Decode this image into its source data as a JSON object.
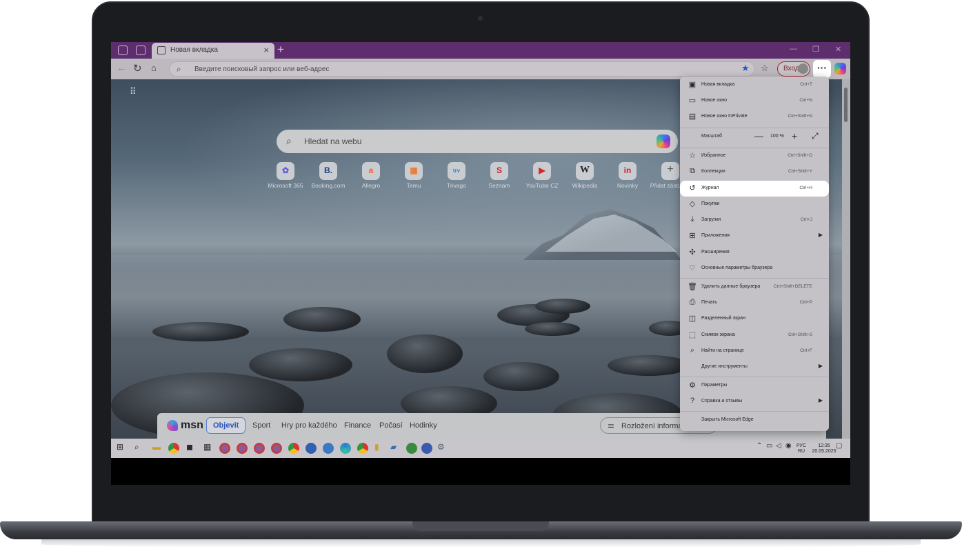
{
  "browser": {
    "tab_title": "Новая вкладка",
    "address_placeholder": "Введите поисковый запрос или веб-адрес",
    "signin_label": "Вход"
  },
  "newtab": {
    "search_placeholder": "Hledat na webu",
    "quick_links": [
      {
        "label": "Microsoft 365",
        "glyph": "✿",
        "color": "#5b5fd8"
      },
      {
        "label": "Booking.com",
        "glyph": "B.",
        "color": "#1f3f8a"
      },
      {
        "label": "Allegro",
        "glyph": "a",
        "color": "#e8622b"
      },
      {
        "label": "Temu",
        "glyph": "▦",
        "color": "#f07a2a"
      },
      {
        "label": "Trivago",
        "glyph": "trv",
        "color": "#2a8ad0"
      },
      {
        "label": "Seznam",
        "glyph": "S",
        "color": "#c8202a"
      },
      {
        "label": "YouTube CZ",
        "glyph": "▶",
        "color": "#d8262a"
      },
      {
        "label": "Wikipedia",
        "glyph": "W",
        "color": "#222222"
      },
      {
        "label": "Novinky",
        "glyph": "in",
        "color": "#c8203a"
      },
      {
        "label": "Přidat zástupce",
        "glyph": "+",
        "color": "#555555"
      }
    ],
    "msn": {
      "logo": "msn",
      "nav": [
        "Objevit",
        "Sport",
        "Hry pro každého",
        "Finance",
        "Počasí",
        "Hodinky"
      ],
      "layout_button": "Rozložení informací"
    }
  },
  "menu": {
    "items": [
      {
        "label": "Новая вкладка",
        "shortcut": "Ctrl+T",
        "icon": "new-tab-icon",
        "glyph": "▣"
      },
      {
        "label": "Новое окно",
        "shortcut": "Ctrl+N",
        "icon": "new-window-icon",
        "glyph": "▭"
      },
      {
        "label": "Новое окно InPrivate",
        "shortcut": "Ctrl+Shift+N",
        "icon": "inprivate-icon",
        "glyph": "▤"
      },
      {
        "label": "Масштаб",
        "shortcut": "",
        "icon": "",
        "glyph": ""
      },
      {
        "label": "Избранное",
        "shortcut": "Ctrl+Shift+O",
        "icon": "favorites-icon",
        "glyph": "☆"
      },
      {
        "label": "Коллекции",
        "shortcut": "Ctrl+Shift+Y",
        "icon": "collections-icon",
        "glyph": "⧉"
      },
      {
        "label": "Журнал",
        "shortcut": "Ctrl+H",
        "icon": "history-icon",
        "glyph": "↺"
      },
      {
        "label": "Покупки",
        "shortcut": "",
        "icon": "shopping-tag-icon",
        "glyph": "◇"
      },
      {
        "label": "Загрузки",
        "shortcut": "Ctrl+J",
        "icon": "download-icon",
        "glyph": "⤓"
      },
      {
        "label": "Приложения",
        "shortcut": "",
        "icon": "apps-icon",
        "glyph": "⊞"
      },
      {
        "label": "Расширения",
        "shortcut": "",
        "icon": "extensions-icon",
        "glyph": "✣"
      },
      {
        "label": "Основные параметры браузера",
        "shortcut": "",
        "icon": "browser-essentials-icon",
        "glyph": "♡"
      },
      {
        "label": "Удалить данные браузера",
        "shortcut": "Ctrl+Shift+DELETE",
        "icon": "trash-icon",
        "glyph": "🗑"
      },
      {
        "label": "Печать",
        "shortcut": "Ctrl+P",
        "icon": "print-icon",
        "glyph": "⎙"
      },
      {
        "label": "Разделенный экран",
        "shortcut": "",
        "icon": "split-screen-icon",
        "glyph": "◫"
      },
      {
        "label": "Снимок экрана",
        "shortcut": "Ctrl+Shift+S",
        "icon": "screenshot-icon",
        "glyph": "⬚"
      },
      {
        "label": "Найти на странице",
        "shortcut": "Ctrl+F",
        "icon": "find-icon",
        "glyph": "⌕"
      },
      {
        "label": "Другие инструменты",
        "shortcut": "",
        "icon": "",
        "glyph": ""
      },
      {
        "label": "Параметры",
        "shortcut": "",
        "icon": "settings-icon",
        "glyph": "⚙"
      },
      {
        "label": "Справка и отзывы",
        "shortcut": "",
        "icon": "help-icon",
        "glyph": "?"
      },
      {
        "label": "Закрыть Microsoft Edge",
        "shortcut": "",
        "icon": "",
        "glyph": ""
      }
    ],
    "zoom_value": "100 %",
    "highlighted": "Журнал"
  },
  "taskbar": {
    "lang_top": "РУС",
    "lang_bottom": "RU",
    "time": "12:35",
    "date": "20.05.2025"
  }
}
